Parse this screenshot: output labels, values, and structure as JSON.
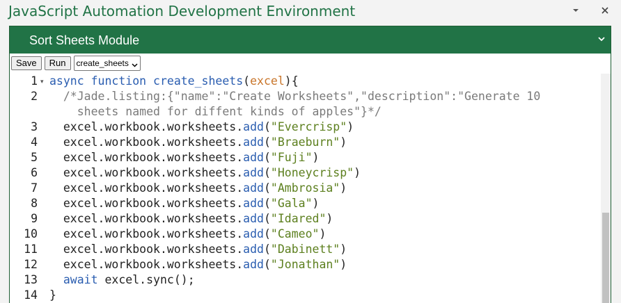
{
  "window": {
    "title": "JavaScript Automation Development Environment",
    "dropdown_icon": "chevron-down-icon",
    "close_icon": "close-icon",
    "accent_color": "#217346"
  },
  "module": {
    "title": "Sort Sheets Module",
    "chevron_icon": "chevron-down-icon"
  },
  "toolbar": {
    "save_label": "Save",
    "run_label": "Run",
    "select_value": "create_sheets"
  },
  "editor": {
    "line_numbers": [
      "1",
      "2",
      "",
      "3",
      "4",
      "5",
      "6",
      "7",
      "8",
      "9",
      "10",
      "11",
      "12",
      "13",
      "14"
    ],
    "lines": [
      {
        "parts": [
          [
            "kw",
            "async "
          ],
          [
            "kw",
            "function "
          ],
          [
            "fn",
            "create_sheets"
          ],
          [
            "",
            "("
          ],
          [
            "param",
            "excel"
          ],
          [
            "",
            ")"
          ],
          [
            "",
            "{"
          ]
        ]
      },
      {
        "parts": [
          [
            "cm",
            "  /*Jade.listing:{\"name\":\"Create Worksheets\",\"description\":\"Generate 10"
          ]
        ]
      },
      {
        "parts": [
          [
            "cm",
            "    sheets named for diffent kinds of apples\"}*/"
          ]
        ]
      },
      {
        "parts": [
          [
            "",
            "  excel.workbook.worksheets."
          ],
          [
            "fn",
            "add"
          ],
          [
            "",
            "("
          ],
          [
            "str",
            "\"Evercrisp\""
          ],
          [
            "",
            ")"
          ]
        ]
      },
      {
        "parts": [
          [
            "",
            "  excel.workbook.worksheets."
          ],
          [
            "fn",
            "add"
          ],
          [
            "",
            "("
          ],
          [
            "str",
            "\"Braeburn\""
          ],
          [
            "",
            ")"
          ]
        ]
      },
      {
        "parts": [
          [
            "",
            "  excel.workbook.worksheets."
          ],
          [
            "fn",
            "add"
          ],
          [
            "",
            "("
          ],
          [
            "str",
            "\"Fuji\""
          ],
          [
            "",
            ")"
          ]
        ]
      },
      {
        "parts": [
          [
            "",
            "  excel.workbook.worksheets."
          ],
          [
            "fn",
            "add"
          ],
          [
            "",
            "("
          ],
          [
            "str",
            "\"Honeycrisp\""
          ],
          [
            "",
            ")"
          ]
        ]
      },
      {
        "parts": [
          [
            "",
            "  excel.workbook.worksheets."
          ],
          [
            "fn",
            "add"
          ],
          [
            "",
            "("
          ],
          [
            "str",
            "\"Ambrosia\""
          ],
          [
            "",
            ")"
          ]
        ]
      },
      {
        "parts": [
          [
            "",
            "  excel.workbook.worksheets."
          ],
          [
            "fn",
            "add"
          ],
          [
            "",
            "("
          ],
          [
            "str",
            "\"Gala\""
          ],
          [
            "",
            ")"
          ]
        ]
      },
      {
        "parts": [
          [
            "",
            "  excel.workbook.worksheets."
          ],
          [
            "fn",
            "add"
          ],
          [
            "",
            "("
          ],
          [
            "str",
            "\"Idared\""
          ],
          [
            "",
            ")"
          ]
        ]
      },
      {
        "parts": [
          [
            "",
            "  excel.workbook.worksheets."
          ],
          [
            "fn",
            "add"
          ],
          [
            "",
            "("
          ],
          [
            "str",
            "\"Cameo\""
          ],
          [
            "",
            ")"
          ]
        ]
      },
      {
        "parts": [
          [
            "",
            "  excel.workbook.worksheets."
          ],
          [
            "fn",
            "add"
          ],
          [
            "",
            "("
          ],
          [
            "str",
            "\"Dabinett\""
          ],
          [
            "",
            ")"
          ]
        ]
      },
      {
        "parts": [
          [
            "",
            "  excel.workbook.worksheets."
          ],
          [
            "fn",
            "add"
          ],
          [
            "",
            "("
          ],
          [
            "str",
            "\"Jonathan\""
          ],
          [
            "",
            ")"
          ]
        ]
      },
      {
        "parts": [
          [
            "kw",
            "  await "
          ],
          [
            "",
            "excel.sync();"
          ]
        ]
      },
      {
        "parts": [
          [
            "",
            "}"
          ]
        ]
      }
    ]
  }
}
